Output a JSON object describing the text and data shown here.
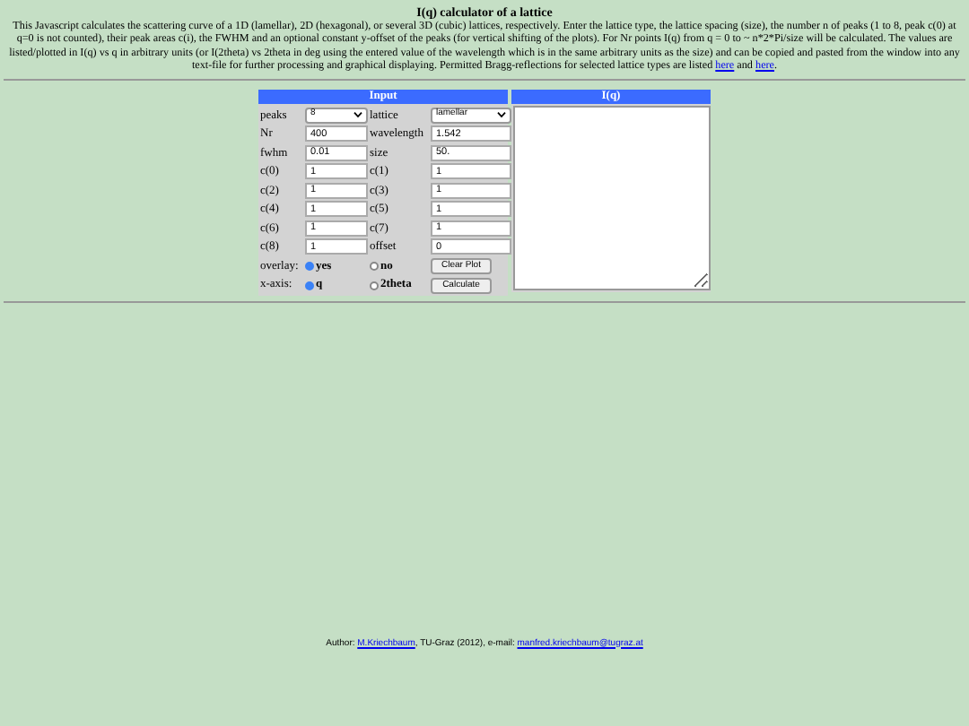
{
  "title": "I(q) calculator of a lattice",
  "description": {
    "text": "This Javascript calculates the scattering curve of a 1D (lamellar), 2D (hexagonal), or several 3D (cubic) lattices, respectively. Enter the lattice type, the lattice spacing (size), the number n of peaks (1 to 8, peak c(0) at q=0 is not counted), their peak areas c(i), the FWHM and an optional constant y-offset of the peaks (for vertical shifting of the plots). For Nr points I(q) from q = 0 to ~ n*2*Pi/size will be calculated. The values are listed/plotted in I(q) vs q in arbitrary units (or I(2theta) vs 2theta in deg using the entered value of the wavelength which is in the same arbitrary units as the size) and can be copied and pasted from the window into any text-file for further processing and graphical displaying. Permitted Bragg-reflections for selected lattice types are listed ",
    "link_1": "here",
    "between": "and",
    "link_2": "here",
    "end": "."
  },
  "input_panel": {
    "title": "Input",
    "rows": [
      [
        {
          "label": "peaks",
          "kind": "select",
          "value": "8"
        },
        {
          "label": "lattice",
          "kind": "select",
          "value": "lamellar"
        }
      ],
      [
        {
          "label": "Nr",
          "kind": "text",
          "value": "400"
        },
        {
          "label": "wavelength",
          "kind": "text",
          "value": "1.542"
        }
      ],
      [
        {
          "label": "fwhm",
          "kind": "text",
          "value": "0.01"
        },
        {
          "label": "size",
          "kind": "text",
          "value": "50."
        }
      ],
      [
        {
          "label": "c(0)",
          "kind": "text",
          "value": "1"
        },
        {
          "label": "c(1)",
          "kind": "text",
          "value": "1"
        }
      ],
      [
        {
          "label": "c(2)",
          "kind": "text",
          "value": "1"
        },
        {
          "label": "c(3)",
          "kind": "text",
          "value": "1"
        }
      ],
      [
        {
          "label": "c(4)",
          "kind": "text",
          "value": "1"
        },
        {
          "label": "c(5)",
          "kind": "text",
          "value": "1"
        }
      ],
      [
        {
          "label": "c(6)",
          "kind": "text",
          "value": "1"
        },
        {
          "label": "c(7)",
          "kind": "text",
          "value": "1"
        }
      ],
      [
        {
          "label": "c(8)",
          "kind": "text",
          "value": "1"
        },
        {
          "label": "offset",
          "kind": "text",
          "value": "0"
        }
      ]
    ],
    "radio_rows": [
      {
        "label": "overlay:",
        "options": [
          {
            "label": "yes",
            "selected": true
          },
          {
            "label": "no",
            "selected": false
          }
        ],
        "button": "Clear Plot"
      },
      {
        "label": "x-axis:",
        "options": [
          {
            "label": "q",
            "selected": true
          },
          {
            "label": "2theta",
            "selected": false
          }
        ],
        "button": "Calculate"
      }
    ]
  },
  "output_panel": {
    "title": "I(q)"
  },
  "footer": {
    "prefix": "Author:",
    "author_link": "M.Kriechbaum",
    "middle": ", TU-Graz (2012), e-mail:",
    "email_link": "manfred.kriechbaum@tugraz.at"
  }
}
